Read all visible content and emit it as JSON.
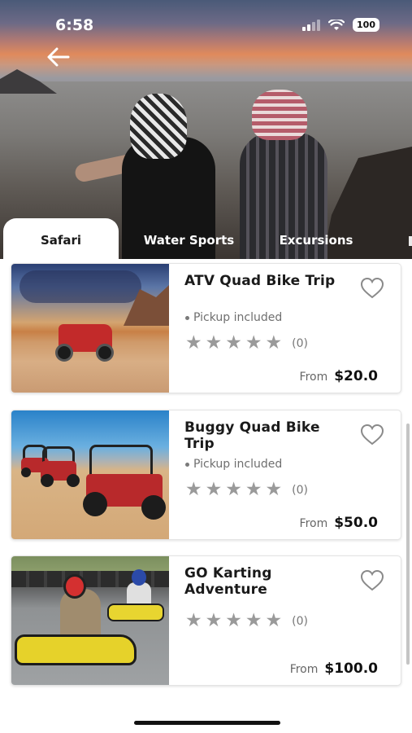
{
  "status_bar": {
    "time": "6:58",
    "battery": "100"
  },
  "navigation": {
    "back_icon": "arrow-left-icon"
  },
  "tabs": [
    {
      "label": "Safari",
      "active": true
    },
    {
      "label": "Water Sports",
      "active": false
    },
    {
      "label": "Excursions",
      "active": false
    }
  ],
  "tours": [
    {
      "title": "ATV Quad Bike Trip",
      "pickup": "Pickup included",
      "rating_count": "(0)",
      "price_prefix": "From",
      "price": "$20.0",
      "image": "atv-quad-bike-photo"
    },
    {
      "title": "Buggy Quad Bike Trip",
      "pickup": "Pickup included",
      "rating_count": "(0)",
      "price_prefix": "From",
      "price": "$50.0",
      "image": "buggy-photo"
    },
    {
      "title": "GO Karting Adventure",
      "pickup": "",
      "rating_count": "(0)",
      "price_prefix": "From",
      "price": "$100.0",
      "image": "go-kart-photo"
    }
  ],
  "colors": {
    "star": "#9a9a9a",
    "accent_text": "#1a1a1a",
    "heart": "#8a8a8a"
  }
}
